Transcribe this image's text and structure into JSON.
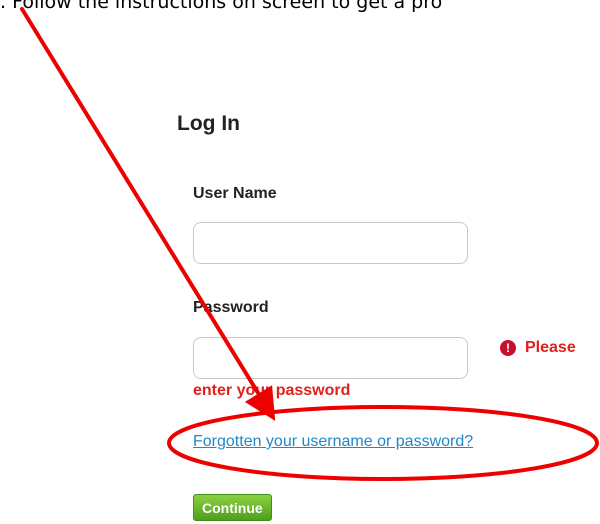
{
  "instruction": {
    "text": ". Follow the instructions on screen to get a pro"
  },
  "login": {
    "title": "Log In",
    "username_label": "User Name",
    "username_value": "",
    "password_label": "Password",
    "password_value": "",
    "error_icon_glyph": "!",
    "error_line_1": "Please",
    "error_line_2": "enter your password",
    "forgot_link": "Forgotten your username or password?",
    "continue_label": "Continue"
  },
  "icons": {
    "error": "error-icon"
  },
  "colors": {
    "error_red": "#e0201b",
    "link_blue": "#1f88c8",
    "button_green": "#5fae25",
    "annotation_red": "#ee0000"
  }
}
